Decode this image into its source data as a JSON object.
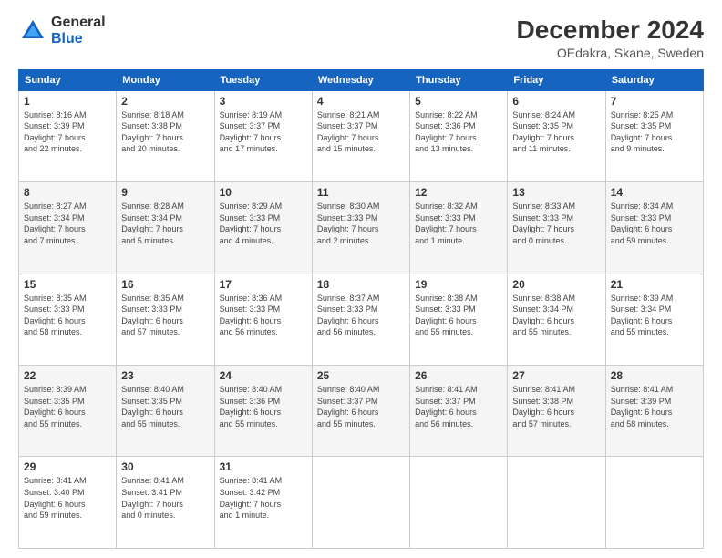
{
  "logo": {
    "general": "General",
    "blue": "Blue"
  },
  "title": "December 2024",
  "subtitle": "OEdakra, Skane, Sweden",
  "days_of_week": [
    "Sunday",
    "Monday",
    "Tuesday",
    "Wednesday",
    "Thursday",
    "Friday",
    "Saturday"
  ],
  "weeks": [
    [
      {
        "day": "1",
        "sunrise": "8:16 AM",
        "sunset": "3:39 PM",
        "daylight": "7 hours and 22 minutes."
      },
      {
        "day": "2",
        "sunrise": "8:18 AM",
        "sunset": "3:38 PM",
        "daylight": "7 hours and 20 minutes."
      },
      {
        "day": "3",
        "sunrise": "8:19 AM",
        "sunset": "3:37 PM",
        "daylight": "7 hours and 17 minutes."
      },
      {
        "day": "4",
        "sunrise": "8:21 AM",
        "sunset": "3:37 PM",
        "daylight": "7 hours and 15 minutes."
      },
      {
        "day": "5",
        "sunrise": "8:22 AM",
        "sunset": "3:36 PM",
        "daylight": "7 hours and 13 minutes."
      },
      {
        "day": "6",
        "sunrise": "8:24 AM",
        "sunset": "3:35 PM",
        "daylight": "7 hours and 11 minutes."
      },
      {
        "day": "7",
        "sunrise": "8:25 AM",
        "sunset": "3:35 PM",
        "daylight": "7 hours and 9 minutes."
      }
    ],
    [
      {
        "day": "8",
        "sunrise": "8:27 AM",
        "sunset": "3:34 PM",
        "daylight": "7 hours and 7 minutes."
      },
      {
        "day": "9",
        "sunrise": "8:28 AM",
        "sunset": "3:34 PM",
        "daylight": "7 hours and 5 minutes."
      },
      {
        "day": "10",
        "sunrise": "8:29 AM",
        "sunset": "3:33 PM",
        "daylight": "7 hours and 4 minutes."
      },
      {
        "day": "11",
        "sunrise": "8:30 AM",
        "sunset": "3:33 PM",
        "daylight": "7 hours and 2 minutes."
      },
      {
        "day": "12",
        "sunrise": "8:32 AM",
        "sunset": "3:33 PM",
        "daylight": "7 hours and 1 minute."
      },
      {
        "day": "13",
        "sunrise": "8:33 AM",
        "sunset": "3:33 PM",
        "daylight": "7 hours and 0 minutes."
      },
      {
        "day": "14",
        "sunrise": "8:34 AM",
        "sunset": "3:33 PM",
        "daylight": "6 hours and 59 minutes."
      }
    ],
    [
      {
        "day": "15",
        "sunrise": "8:35 AM",
        "sunset": "3:33 PM",
        "daylight": "6 hours and 58 minutes."
      },
      {
        "day": "16",
        "sunrise": "8:35 AM",
        "sunset": "3:33 PM",
        "daylight": "6 hours and 57 minutes."
      },
      {
        "day": "17",
        "sunrise": "8:36 AM",
        "sunset": "3:33 PM",
        "daylight": "6 hours and 56 minutes."
      },
      {
        "day": "18",
        "sunrise": "8:37 AM",
        "sunset": "3:33 PM",
        "daylight": "6 hours and 56 minutes."
      },
      {
        "day": "19",
        "sunrise": "8:38 AM",
        "sunset": "3:33 PM",
        "daylight": "6 hours and 55 minutes."
      },
      {
        "day": "20",
        "sunrise": "8:38 AM",
        "sunset": "3:34 PM",
        "daylight": "6 hours and 55 minutes."
      },
      {
        "day": "21",
        "sunrise": "8:39 AM",
        "sunset": "3:34 PM",
        "daylight": "6 hours and 55 minutes."
      }
    ],
    [
      {
        "day": "22",
        "sunrise": "8:39 AM",
        "sunset": "3:35 PM",
        "daylight": "6 hours and 55 minutes."
      },
      {
        "day": "23",
        "sunrise": "8:40 AM",
        "sunset": "3:35 PM",
        "daylight": "6 hours and 55 minutes."
      },
      {
        "day": "24",
        "sunrise": "8:40 AM",
        "sunset": "3:36 PM",
        "daylight": "6 hours and 55 minutes."
      },
      {
        "day": "25",
        "sunrise": "8:40 AM",
        "sunset": "3:37 PM",
        "daylight": "6 hours and 55 minutes."
      },
      {
        "day": "26",
        "sunrise": "8:41 AM",
        "sunset": "3:37 PM",
        "daylight": "6 hours and 56 minutes."
      },
      {
        "day": "27",
        "sunrise": "8:41 AM",
        "sunset": "3:38 PM",
        "daylight": "6 hours and 57 minutes."
      },
      {
        "day": "28",
        "sunrise": "8:41 AM",
        "sunset": "3:39 PM",
        "daylight": "6 hours and 58 minutes."
      }
    ],
    [
      {
        "day": "29",
        "sunrise": "8:41 AM",
        "sunset": "3:40 PM",
        "daylight": "6 hours and 59 minutes."
      },
      {
        "day": "30",
        "sunrise": "8:41 AM",
        "sunset": "3:41 PM",
        "daylight": "7 hours and 0 minutes."
      },
      {
        "day": "31",
        "sunrise": "8:41 AM",
        "sunset": "3:42 PM",
        "daylight": "7 hours and 1 minute."
      },
      null,
      null,
      null,
      null
    ]
  ]
}
